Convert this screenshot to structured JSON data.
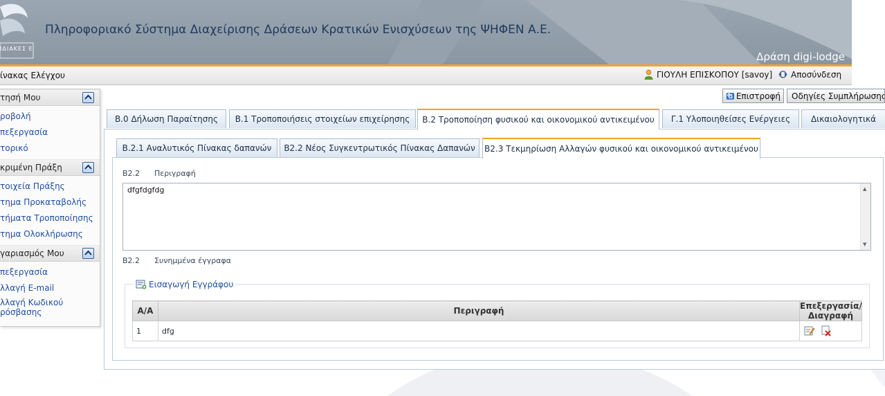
{
  "header": {
    "logo_text": "ΙΔΙΑΚΕΣ ΕΝΙΣΧΥΣΕΙΣ Α.Ε.",
    "app_title": "Πληροφοριακό Σύστημα Διαχείρισης Δράσεων Κρατικών Ενισχύσεων της ΨΗΦΕΝ Α.Ε.",
    "action_title": "Δράση digi-lodge",
    "accent_color": "#f4a226"
  },
  "topbar": {
    "title": "ίνακας Ελέγχου",
    "user": "ΓΙΟΥΛΗ ΕΠΙΣΚΟΠΟΥ [savoy]",
    "logout": "Αποσύνδεση"
  },
  "sidebar": {
    "sections": [
      {
        "title": "τησή Μου",
        "items": [
          "ροβολή",
          "πεξεργασία",
          "τορικό"
        ]
      },
      {
        "title": "κριμένη Πράξη",
        "items": [
          "τοιχεία Πράξης",
          "τημα Προκαταβολής",
          "τήματα Τροποποίησης",
          "τημα Ολοκλήρωσης"
        ]
      },
      {
        "title": "γαριασμός Μου",
        "items": [
          "πεξεργασία",
          "λλαγή E-mail",
          "λλαγή Κωδικού ρόσβασης"
        ]
      }
    ]
  },
  "buttons": {
    "back": "Επιστροφή",
    "help": "Οδηγίες Συμπλήρωσης"
  },
  "main_tabs": [
    "Β.0 Δήλωση Παραίτησης",
    "Β.1 Τροποποιήσεις στοιχείων επιχείρησης",
    "Β.2 Τροποποίηση φυσικού και οικονομικού αντικειμένου",
    "Γ.1 Υλοποιηθείσες Ενέργειες",
    "Δικαιολογητικά"
  ],
  "sub_tabs": [
    "Β.2.1 Αναλυτικός Πίνακας δαπανών",
    "Β2.2 Νέος Συγκεντρωτικός Πίνακας Δαπανών",
    "Β2.3 Τεκμηρίωση Αλλαγών φυσικού και οικονομικού αντικειμένου"
  ],
  "form": {
    "description_code": "Β2.2",
    "description_label": "Περιγραφή",
    "description_value": "dfgfdgfdg",
    "attachments_code": "Β2.2",
    "attachments_label": "Συνημμένα έγγραφα",
    "add_document": "Εισαγωγή Εγγράφου"
  },
  "doc_table": {
    "headers": [
      "Α/Α",
      "Περιγραφή",
      "Επεξεργασία/ Διαγραφή"
    ],
    "rows": [
      {
        "index": "1",
        "description": "dfg"
      }
    ]
  }
}
